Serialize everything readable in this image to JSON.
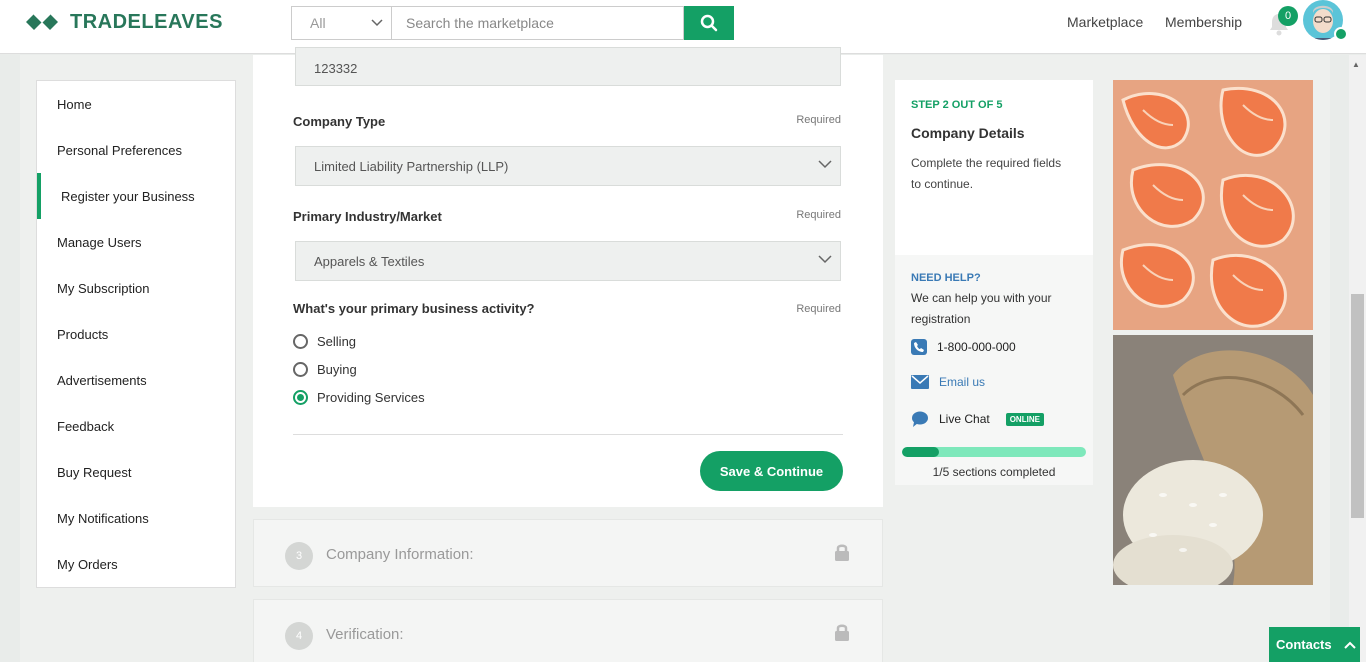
{
  "brand": {
    "name": "TRADELEAVES",
    "color": "#14a065"
  },
  "search": {
    "category": "All",
    "placeholder": "Search the marketplace",
    "icon": "search-icon"
  },
  "nav": {
    "marketplace": "Marketplace",
    "membership": "Membership",
    "notifications_count": "0"
  },
  "sidebar": {
    "items": [
      {
        "label": "Home"
      },
      {
        "label": "Personal Preferences"
      },
      {
        "label": "Register your Business",
        "active": true
      },
      {
        "label": "Manage Users"
      },
      {
        "label": "My Subscription"
      },
      {
        "label": "Products"
      },
      {
        "label": "Advertisements"
      },
      {
        "label": "Feedback"
      },
      {
        "label": "Buy Request"
      },
      {
        "label": "My Notifications"
      },
      {
        "label": "My Orders"
      }
    ]
  },
  "form": {
    "top_field_value": "123332",
    "company_type": {
      "label": "Company Type",
      "required": "Required",
      "value": "Limited Liability Partnership (LLP)"
    },
    "industry": {
      "label": "Primary Industry/Market",
      "required": "Required",
      "value": "Apparels & Textiles"
    },
    "activity": {
      "label": "What's your primary business activity?",
      "required": "Required",
      "options": [
        "Selling",
        "Buying",
        "Providing Services"
      ],
      "selected": "Providing Services"
    },
    "save_label": "Save & Continue"
  },
  "sections": [
    {
      "number": "3",
      "title": "Company Information:"
    },
    {
      "number": "4",
      "title": "Verification:"
    }
  ],
  "step": {
    "tag": "STEP 2 OUT OF 5",
    "title": "Company Details",
    "desc": "Complete the required fields to continue."
  },
  "help": {
    "tag": "NEED HELP?",
    "desc": "We can help you with your registration",
    "phone": "1-800-000-000",
    "email": "Email us",
    "chat": "Live Chat",
    "chat_status": "ONLINE",
    "progress_fraction": 0.2,
    "progress_text": "1/5 sections completed"
  },
  "contacts_label": "Contacts"
}
